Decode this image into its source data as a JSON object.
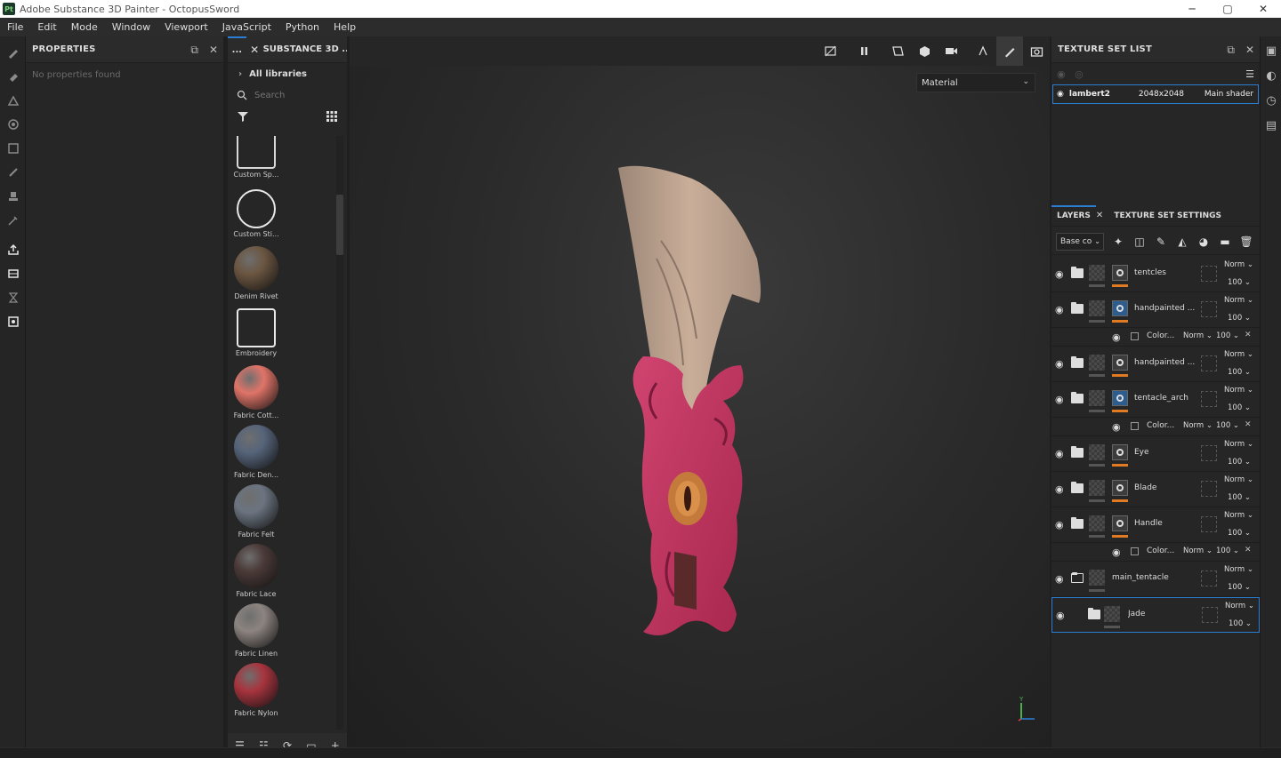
{
  "window": {
    "title": "Adobe Substance 3D Painter - OctopusSword",
    "logo_text": "Pt",
    "minimize": "─",
    "maximize": "▢",
    "close": "✕"
  },
  "menu": [
    "File",
    "Edit",
    "Mode",
    "Window",
    "Viewport",
    "JavaScript",
    "Python",
    "Help"
  ],
  "properties": {
    "title": "PROPERTIES",
    "empty_text": "No properties found"
  },
  "shelf": {
    "tab_dots": "...",
    "tab_label": "SUBSTANCE 3D ...",
    "library_label": "All libraries",
    "search_placeholder": "Search",
    "items": [
      {
        "label": "Custom Sp...",
        "color": "#d8d8d8"
      },
      {
        "label": "Custom Sti...",
        "color": "#e8e8e8"
      },
      {
        "label": "Denim Rivet",
        "color": "#6b5641"
      },
      {
        "label": "Embroidery",
        "color": "#e8e8e8"
      },
      {
        "label": "Fabric Cott...",
        "color": "#e07468"
      },
      {
        "label": "Fabric Den...",
        "color": "#56647a"
      },
      {
        "label": "Fabric Felt",
        "color": "#6b7480"
      },
      {
        "label": "Fabric Lace",
        "color": "#4a3a38"
      },
      {
        "label": "Fabric Linen",
        "color": "#8c8480"
      },
      {
        "label": "Fabric Nylon",
        "color": "#a8343e"
      }
    ]
  },
  "viewport": {
    "material_mode": "Material",
    "axis_label": "Y"
  },
  "texture_set_list": {
    "title": "TEXTURE SET LIST",
    "row": {
      "name": "lambert2",
      "resolution": "2048x2048",
      "shader": "Main shader"
    }
  },
  "layers": {
    "tab_layers": "LAYERS",
    "tab_settings": "TEXTURE SET SETTINGS",
    "channel": "Base co",
    "items": [
      {
        "type": "layer",
        "name": "tentcles",
        "blend": "Norm",
        "opacity": "100",
        "blue": false
      },
      {
        "type": "layer",
        "name": "handpainted ...",
        "blend": "Norm",
        "opacity": "100",
        "blue": true
      },
      {
        "type": "sub",
        "name": "Color...",
        "blend": "Norm",
        "opacity": "100"
      },
      {
        "type": "layer",
        "name": "handpainted ...",
        "blend": "Norm",
        "opacity": "100",
        "blue": false
      },
      {
        "type": "layer",
        "name": "tentacle_arch",
        "blend": "Norm",
        "opacity": "100",
        "blue": true
      },
      {
        "type": "sub",
        "name": "Color...",
        "blend": "Norm",
        "opacity": "100"
      },
      {
        "type": "layer",
        "name": "Eye",
        "blend": "Norm",
        "opacity": "100",
        "blue": false
      },
      {
        "type": "layer",
        "name": "Blade",
        "blend": "Norm",
        "opacity": "100",
        "blue": false
      },
      {
        "type": "layer",
        "name": "Handle",
        "blend": "Norm",
        "opacity": "100",
        "blue": false
      },
      {
        "type": "sub",
        "name": "Color...",
        "blend": "Norm",
        "opacity": "100"
      },
      {
        "type": "group",
        "name": "main_tentacle",
        "blend": "Norm",
        "opacity": "100"
      },
      {
        "type": "folder",
        "name": "Jade",
        "blend": "Norm",
        "opacity": "100"
      }
    ]
  },
  "colors": {
    "accent": "#2a7fd5",
    "orange": "#e07b23"
  }
}
